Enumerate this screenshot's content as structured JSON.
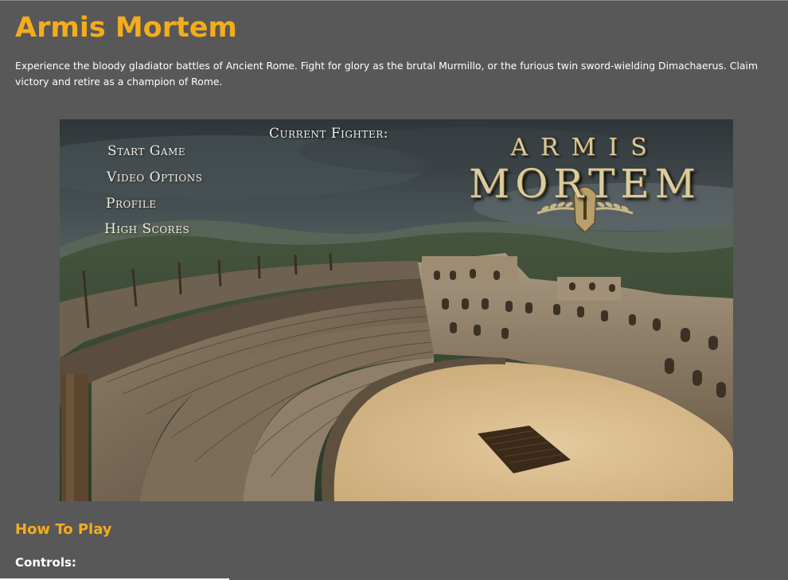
{
  "page": {
    "title": "Armis Mortem",
    "intro": "Experience the bloody gladiator battles of Ancient Rome. Fight for glory as the brutal Murmillo, or the furious twin sword-wielding Dimachaerus. Claim victory and retire as a champion of Rome.",
    "how_to_play_heading": "How To Play",
    "controls_heading": "Controls:"
  },
  "game_screenshot": {
    "menu": [
      {
        "label": "Start Game"
      },
      {
        "label": "Video Options"
      },
      {
        "label": "Profile"
      },
      {
        "label": "High Scores"
      }
    ],
    "current_fighter_label": "Current Fighter:",
    "logo": {
      "line1": "ARMIS",
      "line2": "MORTEM"
    }
  },
  "colors": {
    "background": "#585858",
    "accent": "#f5ac1c",
    "text": "#ffffff"
  }
}
